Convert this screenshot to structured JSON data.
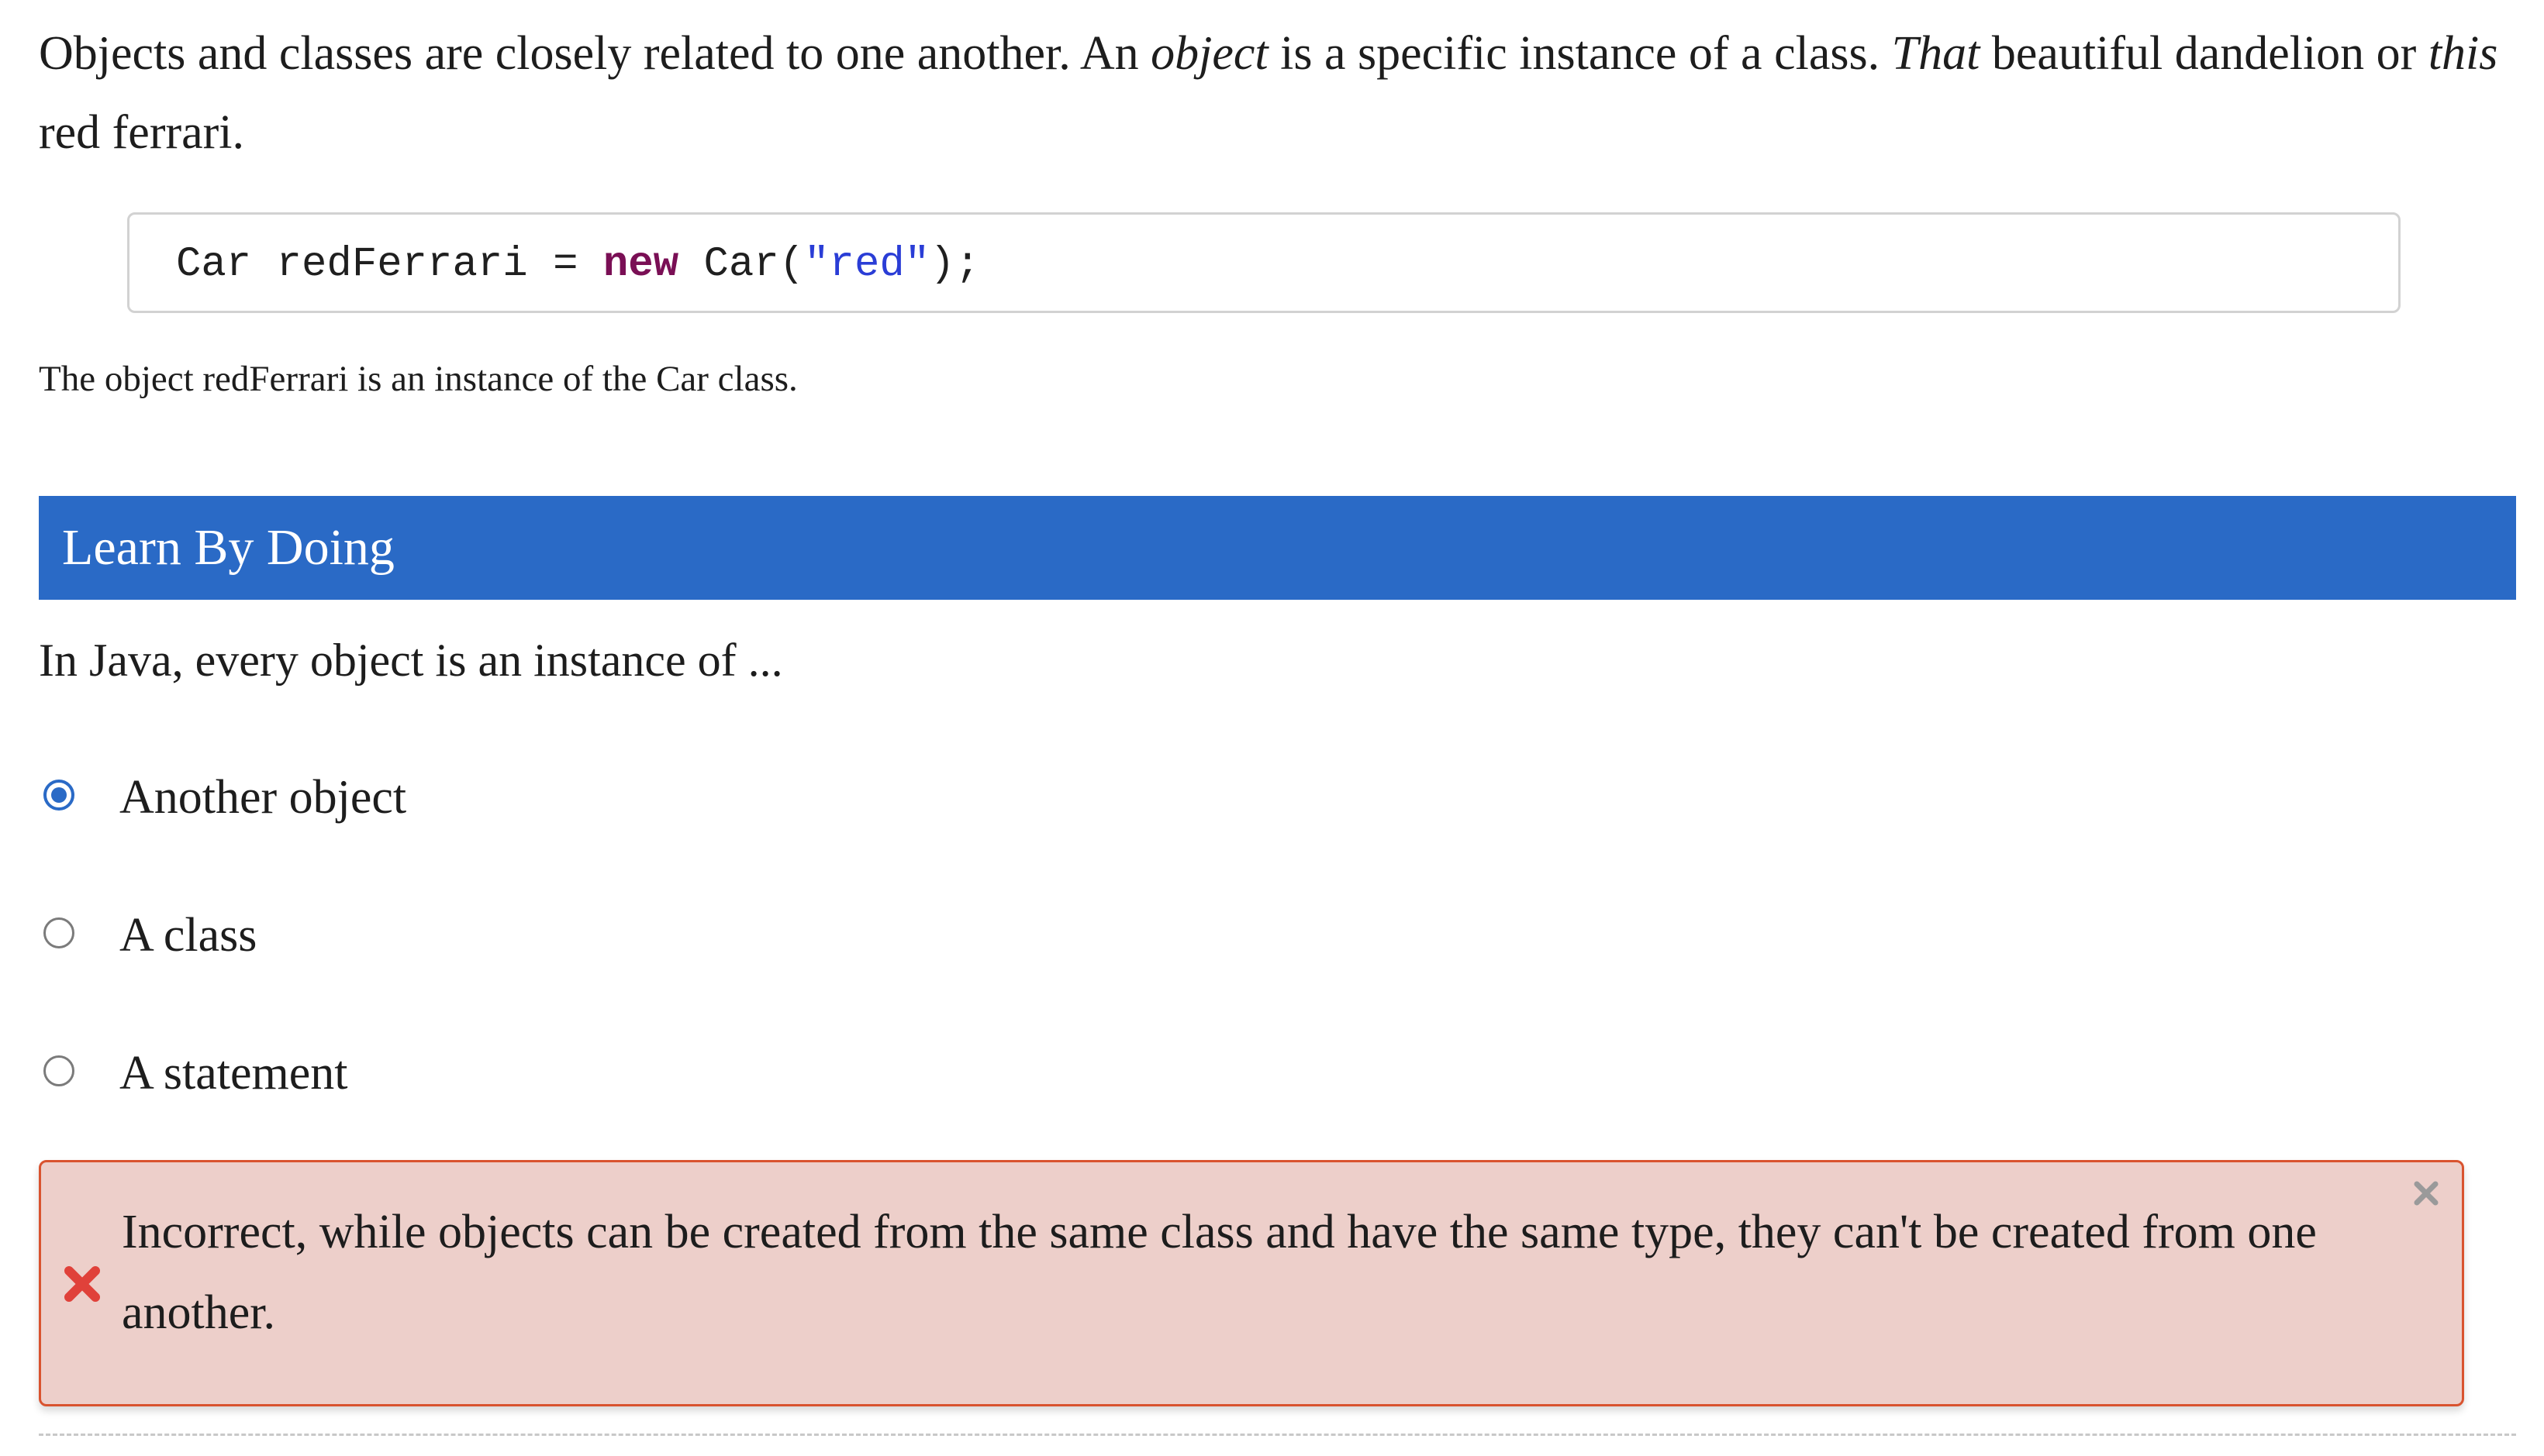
{
  "intro": {
    "part1": "Objects and classes are closely related to one another. An ",
    "em1": "object",
    "part2": " is a specific instance of a class. ",
    "em2": "That",
    "part3": " beautiful dandelion or ",
    "em3": "this",
    "part4": " red ferrari."
  },
  "code": {
    "part1": "Car redFerrari = ",
    "keyword": "new",
    "part2": " Car(",
    "string": "\"red\"",
    "part3": ");"
  },
  "caption": "The object redFerrari is an instance of the Car class.",
  "learn_by_doing": {
    "title": "Learn By Doing"
  },
  "question": {
    "text": "In Java, every object is an instance of ...",
    "options": [
      {
        "label": "Another object",
        "selected": true
      },
      {
        "label": "A class",
        "selected": false
      },
      {
        "label": "A statement",
        "selected": false
      }
    ]
  },
  "feedback": {
    "status": "incorrect",
    "icon": "x-mark-icon",
    "text": "Incorrect, while objects can be created from the same class and have the same type, they can't be created from one another.",
    "close_icon": "close-icon"
  },
  "colors": {
    "accent": "#2a6ac6",
    "code_keyword": "#7a0f55",
    "code_string": "#2a3dd6",
    "feedback_bg": "#edcfca",
    "feedback_border": "#d9532f",
    "error_icon": "#e0413a"
  }
}
